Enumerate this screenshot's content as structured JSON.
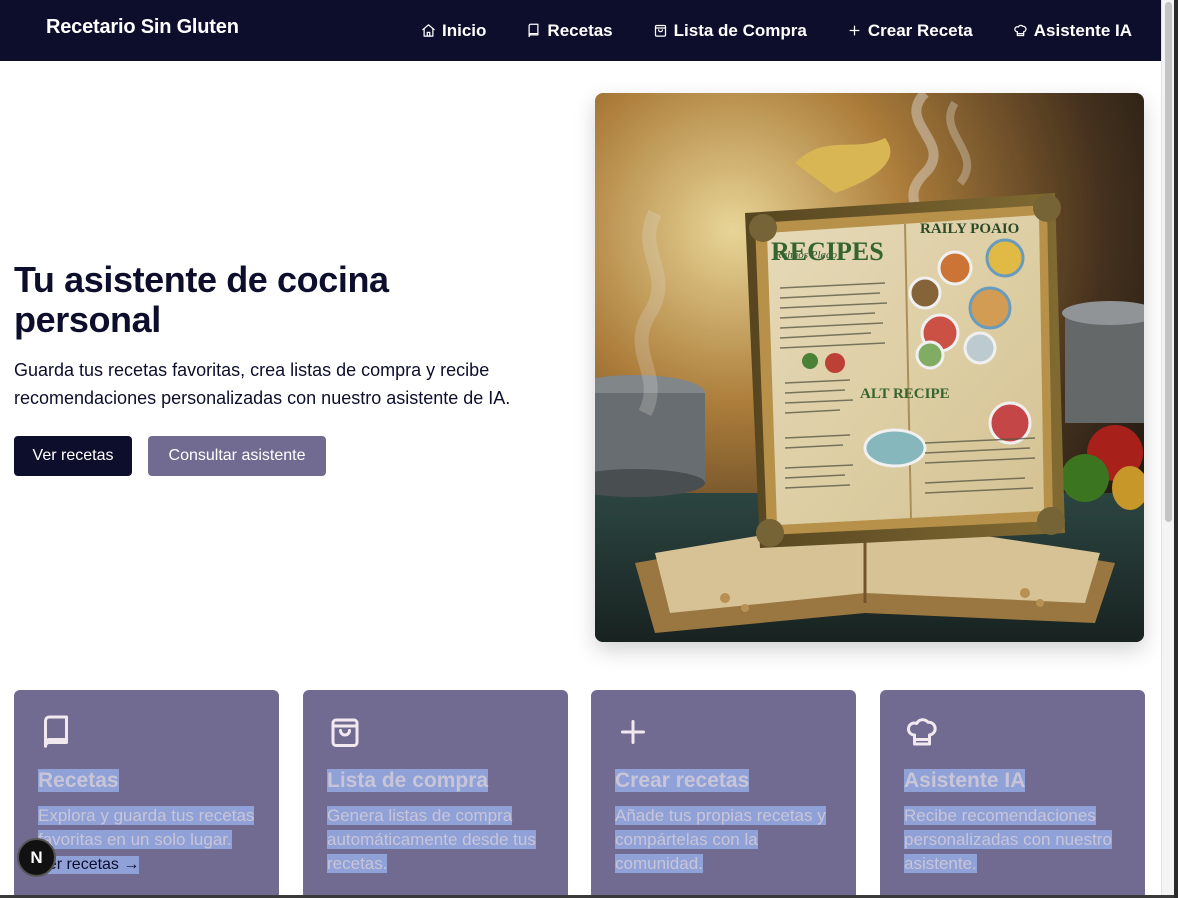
{
  "nav": {
    "brand": "Recetario Sin Gluten",
    "items": [
      {
        "label": "Inicio",
        "icon": "home-icon"
      },
      {
        "label": "Recetas",
        "icon": "book-icon"
      },
      {
        "label": "Lista de Compra",
        "icon": "shopping-bag-icon"
      },
      {
        "label": "Crear Receta",
        "icon": "plus-icon"
      },
      {
        "label": "Asistente IA",
        "icon": "chef-hat-icon"
      }
    ]
  },
  "hero": {
    "title": "Tu asistente de cocina personal",
    "subtitle": "Guarda tus recetas favoritas, crea listas de compra y recibe recomendaciones personalizadas con nuestro asistente de IA.",
    "primary_button": "Ver recetas",
    "secondary_button": "Consultar asistente",
    "image_text": {
      "cover_title": "RECIPES",
      "top_right": "RAILY POAIO",
      "mid_label": "ALT RECIPE"
    }
  },
  "features": [
    {
      "icon": "book-icon",
      "title": "Recetas",
      "text": "Explora y guarda tus recetas favoritas en un solo lugar.",
      "link": "Ver recetas →"
    },
    {
      "icon": "shopping-bag-icon",
      "title": "Lista de compra",
      "text": "Genera listas de compra automáticamente desde tus recetas.",
      "link": ""
    },
    {
      "icon": "plus-icon",
      "title": "Crear recetas",
      "text": "Añade tus propias recetas y compártelas con la comunidad.",
      "link": ""
    },
    {
      "icon": "chef-hat-icon",
      "title": "Asistente IA",
      "text": "Recibe recomendaciones personalizadas con nuestro asistente.",
      "link": ""
    }
  ],
  "dev_badge": "N",
  "colors": {
    "nav_bg": "#0d0e2c",
    "primary": "#0d0e2c",
    "secondary": "#726b91",
    "selection": "#8fa1d6"
  }
}
